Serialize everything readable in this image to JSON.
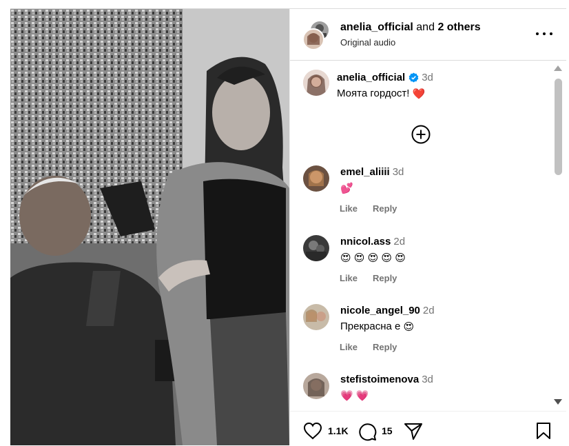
{
  "header": {
    "username": "anelia_official",
    "and_text": "and",
    "others_text": "2 others",
    "subtitle": "Original audio"
  },
  "caption": {
    "username": "anelia_official",
    "time": "3d",
    "text": "Моята гордост!",
    "emoji": "❤️"
  },
  "comments": [
    {
      "username": "emel_aliiii",
      "time": "3d",
      "text": "",
      "emoji": "💕",
      "like": "Like",
      "reply": "Reply"
    },
    {
      "username": "nnicol.ass",
      "time": "2d",
      "text": "",
      "emoji": "😍 😍 😍 😍 😍",
      "like": "Like",
      "reply": "Reply"
    },
    {
      "username": "nicole_angel_90",
      "time": "2d",
      "text": "Прекрасна е",
      "emoji": "😍",
      "like": "Like",
      "reply": "Reply"
    },
    {
      "username": "stefistoimenova",
      "time": "3d",
      "text": "",
      "emoji": "💗 💗",
      "like": "",
      "reply": ""
    }
  ],
  "footer": {
    "likes": "1.1K",
    "comments": "15"
  },
  "icons": [
    "more-icon",
    "verified-badge-icon",
    "add-comment-icon",
    "heart-icon",
    "comment-icon",
    "share-icon",
    "bookmark-icon"
  ],
  "colors": {
    "accent_heart": "#ed4956",
    "verified": "#0095f6",
    "muted": "#737373"
  }
}
